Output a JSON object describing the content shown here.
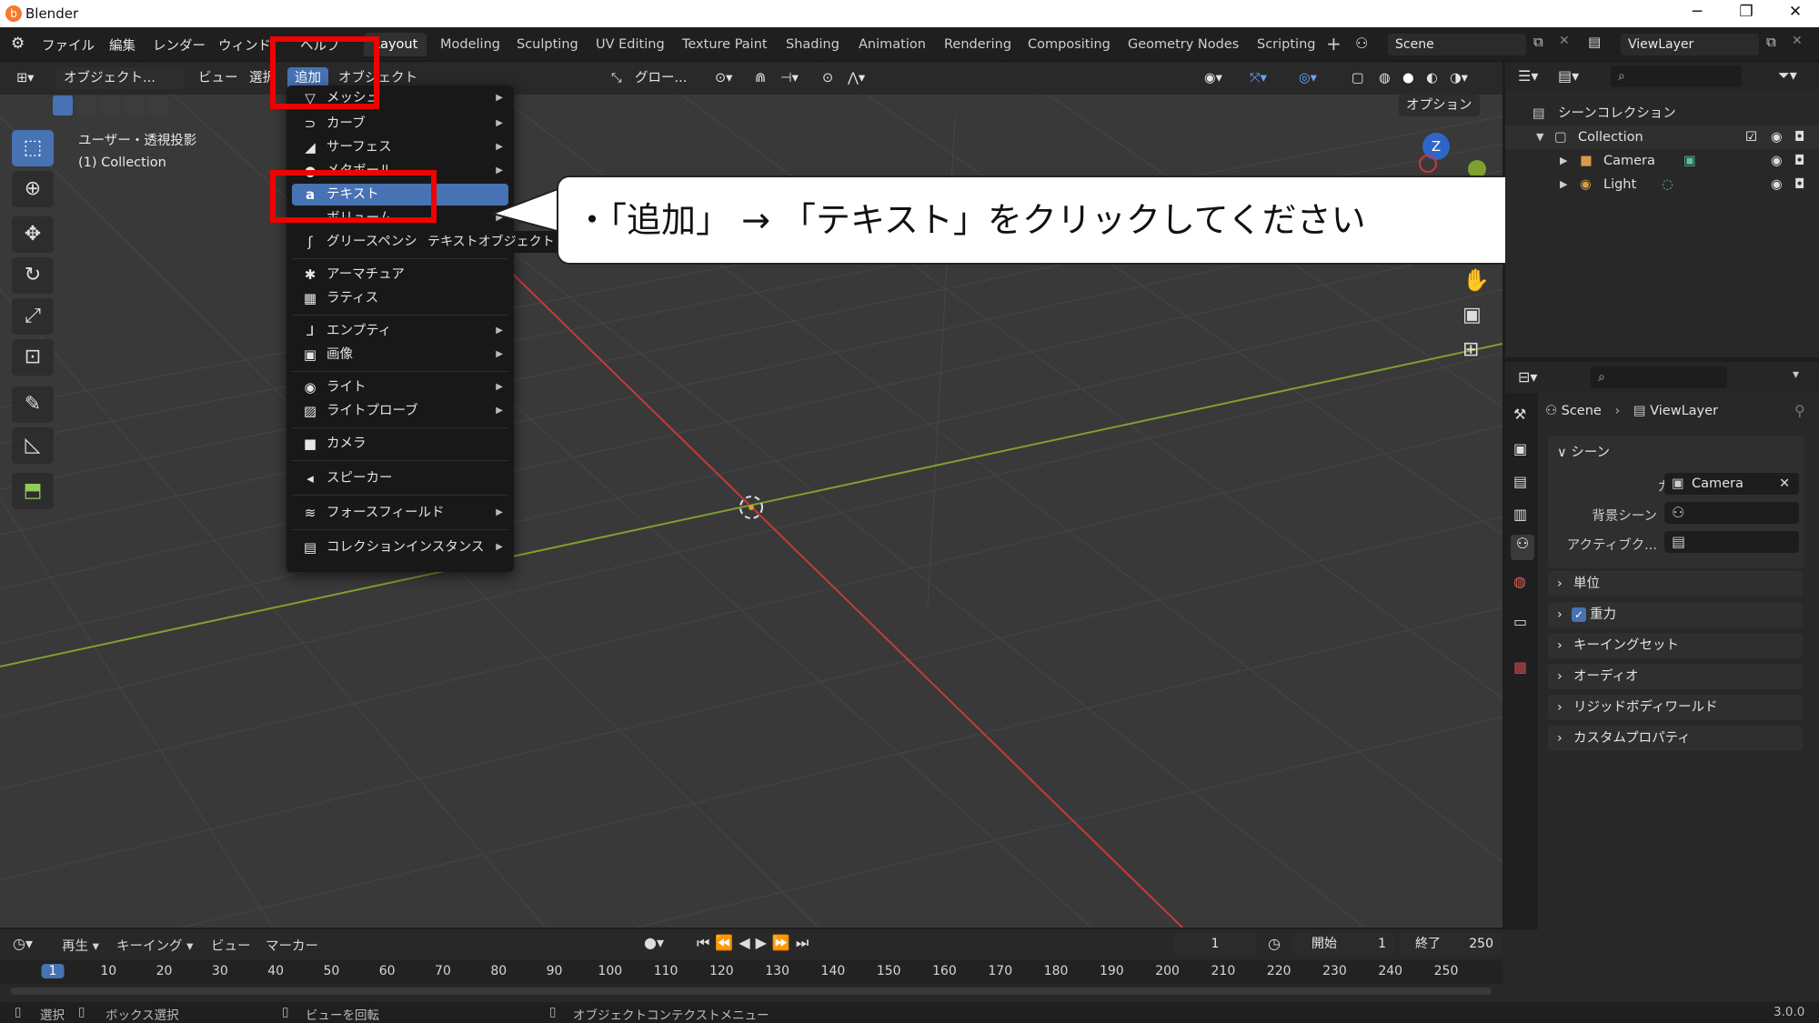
{
  "window": {
    "title": "Blender",
    "minimize": "─",
    "maximize": "❐",
    "close": "✕"
  },
  "topbar": {
    "menus": [
      "ファイル",
      "編集",
      "レンダー",
      "ウィンド",
      "ヘルプ"
    ],
    "tabs": [
      "Layout",
      "Modeling",
      "Sculpting",
      "UV Editing",
      "Texture Paint",
      "Shading",
      "Animation",
      "Rendering",
      "Compositing",
      "Geometry Nodes",
      "Scripting"
    ],
    "active_tab": "Layout",
    "add_workspace": "+",
    "scene": "Scene",
    "view_layer": "ViewLayer"
  },
  "viewport_header": {
    "mode": "オブジェクト...",
    "view": "ビュー",
    "select": "選択",
    "add": "追加",
    "object": "オブジェクト",
    "transform_orientation": "グロー...",
    "options": "オプション"
  },
  "viewport_info": {
    "line1": "ユーザー・透視投影",
    "line2": "(1) Collection"
  },
  "add_menu": {
    "items": [
      {
        "label": "メッシュ",
        "icon": "▽",
        "sub": true
      },
      {
        "label": "カーブ",
        "icon": "⊃",
        "sub": true
      },
      {
        "label": "サーフェス",
        "icon": "◢",
        "sub": true
      },
      {
        "label": "メタボール",
        "icon": "●",
        "sub": true
      },
      {
        "label": "テキスト",
        "icon": "a",
        "sub": false
      },
      {
        "label": "ボリューム",
        "icon": "☁",
        "sub": true
      },
      {
        "label": "グリースペンシ",
        "icon": "ʃ",
        "sub": true
      },
      {
        "label": "アーマチュア",
        "icon": "✱",
        "sub": false
      },
      {
        "label": "ラティス",
        "icon": "▦",
        "sub": false
      },
      {
        "label": "エンプティ",
        "icon": "⅃",
        "sub": true
      },
      {
        "label": "画像",
        "icon": "▣",
        "sub": true
      },
      {
        "label": "ライト",
        "icon": "◉",
        "sub": true
      },
      {
        "label": "ライトプローブ",
        "icon": "▨",
        "sub": true
      },
      {
        "label": "カメラ",
        "icon": "■",
        "sub": false
      },
      {
        "label": "スピーカー",
        "icon": "◂",
        "sub": false
      },
      {
        "label": "フォースフィールド",
        "icon": "≋",
        "sub": true
      },
      {
        "label": "コレクションインスタンス",
        "icon": "▤",
        "sub": true
      }
    ],
    "tooltip": "テキストオブジェクト"
  },
  "callout": {
    "text": "・「追加」 → 「テキスト」をクリックしてください"
  },
  "outliner": {
    "root": "シーンコレクション",
    "collection": "Collection",
    "camera": "Camera",
    "light": "Light"
  },
  "properties": {
    "breadcrumb_scene": "Scene",
    "breadcrumb_layer": "ViewLayer",
    "section": "シーン",
    "camera_label": "カメラ",
    "camera_value": "Camera",
    "bg_scene_label": "背景シーン",
    "active_clip_label": "アクティブク...",
    "panels": [
      "単位",
      "重力",
      "キーイングセット",
      "オーディオ",
      "リジッドボディワールド",
      "カスタムプロパティ"
    ]
  },
  "timeline": {
    "playback": "再生",
    "keying": "キーイング",
    "view": "ビュー",
    "marker": "マーカー",
    "current_frame": "1",
    "start_label": "開始",
    "start": "1",
    "end_label": "終了",
    "end": "250",
    "ticks": [
      "1",
      "10",
      "20",
      "30",
      "40",
      "50",
      "60",
      "70",
      "80",
      "90",
      "100",
      "110",
      "120",
      "130",
      "140",
      "150",
      "160",
      "170",
      "180",
      "190",
      "200",
      "210",
      "220",
      "230",
      "240",
      "250"
    ]
  },
  "statusbar": {
    "select": "選択",
    "box_select": "ボックス選択",
    "rotate": "ビューを回転",
    "context_menu": "オブジェクトコンテクストメニュー",
    "version": "3.0.0"
  },
  "colors": {
    "accent": "#4772b3",
    "highlight_box": "#f00200",
    "x_axis": "#c63a3a",
    "y_axis": "#7fa030"
  }
}
